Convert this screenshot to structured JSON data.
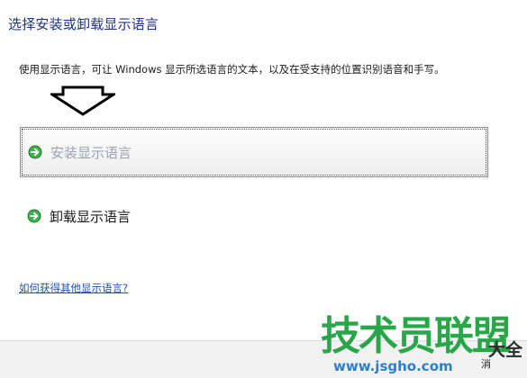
{
  "header": {
    "title": "选择安装或卸载显示语言"
  },
  "description": "使用显示语言，可让 Windows 显示所选语言的文本，以及在受支持的位置识别语音和手写。",
  "options": [
    {
      "label": "安装显示语言",
      "icon": "green-arrow-icon",
      "selected": true
    },
    {
      "label": "卸载显示语言",
      "icon": "green-arrow-icon",
      "selected": false
    }
  ],
  "help_link": "如何获得其他显示语言?",
  "watermark": {
    "brand": "技术员联盟",
    "url": "www.jsgho.com",
    "suffix": "大全"
  },
  "footer": {
    "partial_button_text": "消"
  },
  "colors": {
    "title": "#1e3287",
    "link": "#1e4fc2",
    "accent_green": "#2aa64a"
  }
}
